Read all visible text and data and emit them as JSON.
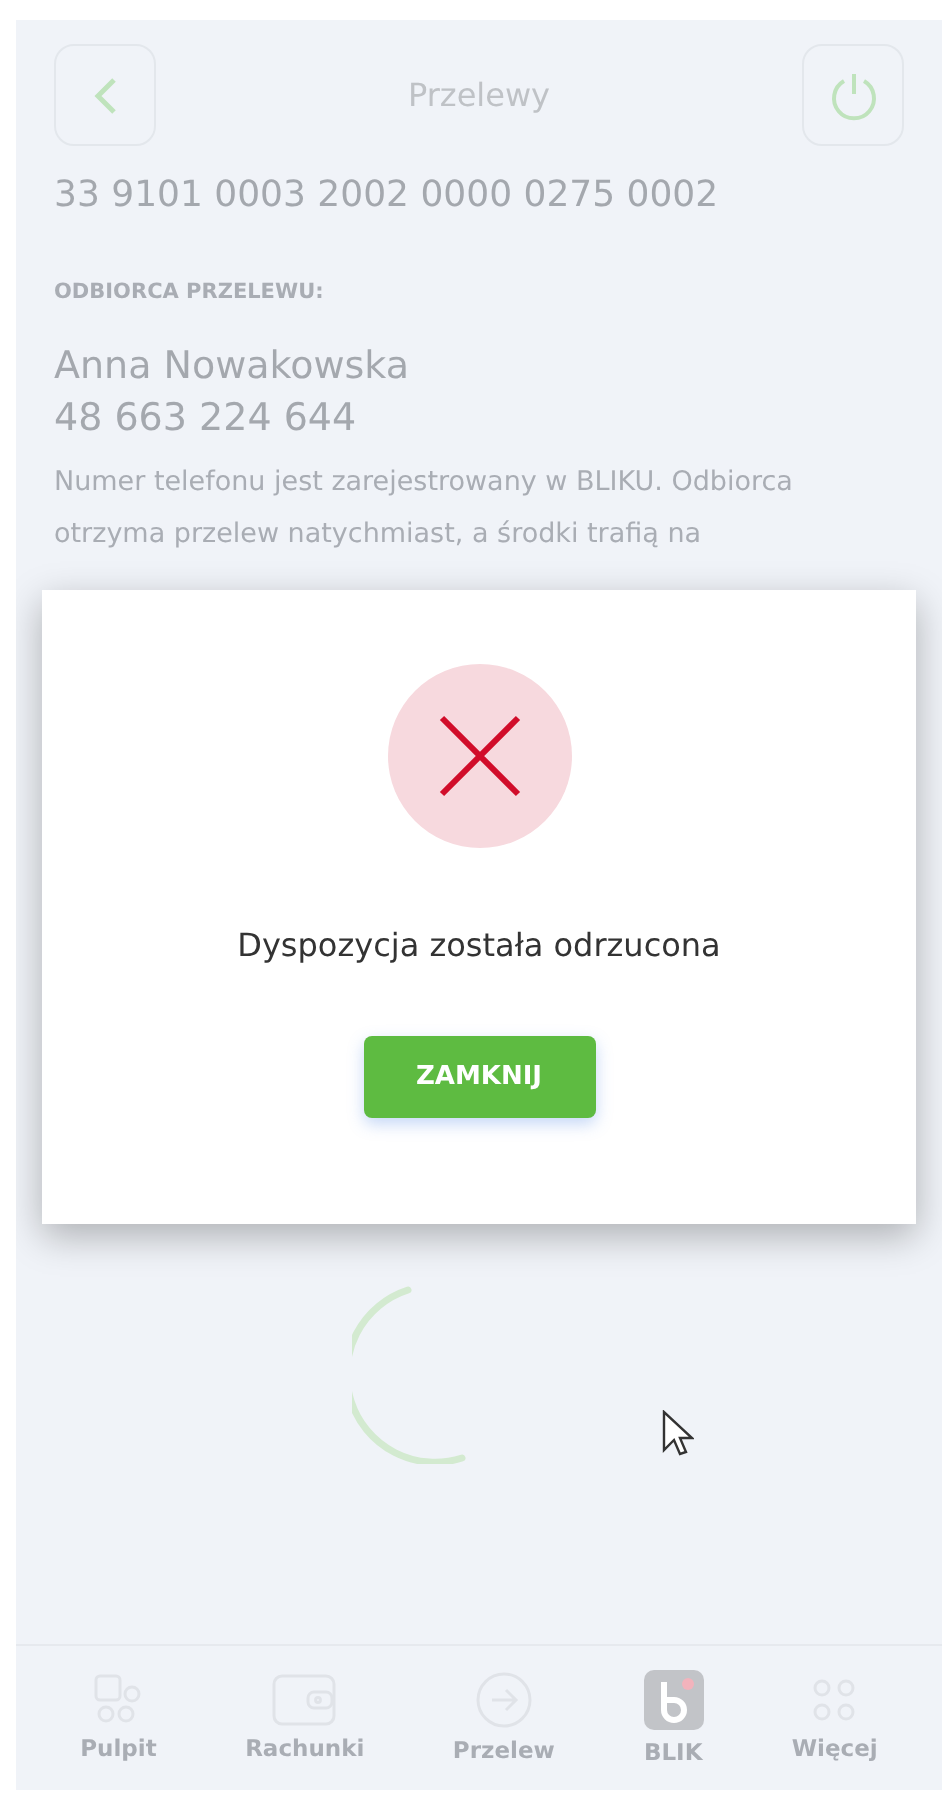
{
  "header": {
    "title": "Przelewy"
  },
  "account_number": "33 9101 0003 2002 0000 0275 0002",
  "recipient": {
    "label": "ODBIORCA PRZELEWU:",
    "name": "Anna Nowakowska",
    "phone": "48 663 224 644",
    "note": "Numer telefonu jest zarejestrowany w BLIKU. Odbiorca otrzyma przelew natychmiast, a środki trafią na"
  },
  "dialog": {
    "message": "Dyspozycja została odrzucona",
    "button": "ZAMKNIJ"
  },
  "nav": [
    {
      "kind": "dashboard",
      "label": "Pulpit"
    },
    {
      "kind": "wallet",
      "label": "Rachunki"
    },
    {
      "kind": "transfer",
      "label": "Przelew"
    },
    {
      "kind": "blik",
      "label": "BLIK"
    },
    {
      "kind": "more",
      "label": "Więcej"
    }
  ]
}
